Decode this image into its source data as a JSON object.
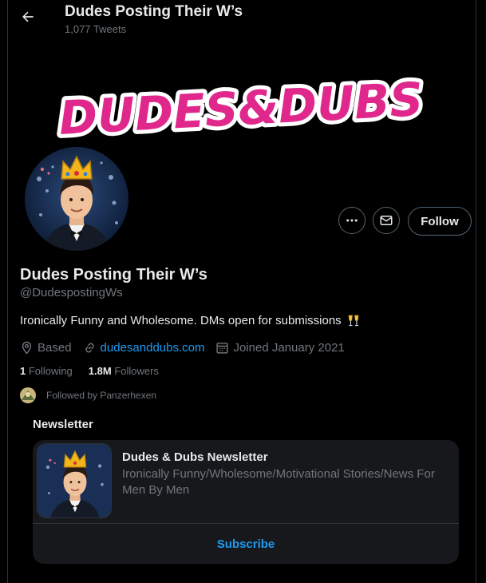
{
  "header": {
    "title": "Dudes Posting Their W’s",
    "tweet_count": "1,077 Tweets"
  },
  "banner": {
    "text": "DUDES&DUBS",
    "color": "#e0288c"
  },
  "actions": {
    "more_icon": "more-icon",
    "message_icon": "mail-icon",
    "follow_label": "Follow"
  },
  "profile": {
    "display_name": "Dudes Posting Their W’s",
    "handle": "@DudespostingWs",
    "bio": "Ironically Funny and Wholesome. DMs open for submissions",
    "bio_emoji": "clinking-glasses-emoji",
    "location": "Based",
    "website": "dudesanddubs.com",
    "joined": "Joined January 2021"
  },
  "stats": {
    "following_count": "1",
    "following_label": "Following",
    "followers_count": "1.8M",
    "followers_label": "Followers"
  },
  "followed_by": "Followed by Panzerhexen",
  "newsletter": {
    "heading": "Newsletter",
    "title": "Dudes & Dubs Newsletter",
    "description": "Ironically Funny/Wholesome/Motivational Stories/News For Men By Men",
    "subscribe_label": "Subscribe"
  },
  "colors": {
    "background": "#000000",
    "accent": "#1d9bf0",
    "secondary_text": "#71767b",
    "card": "#16181c"
  }
}
